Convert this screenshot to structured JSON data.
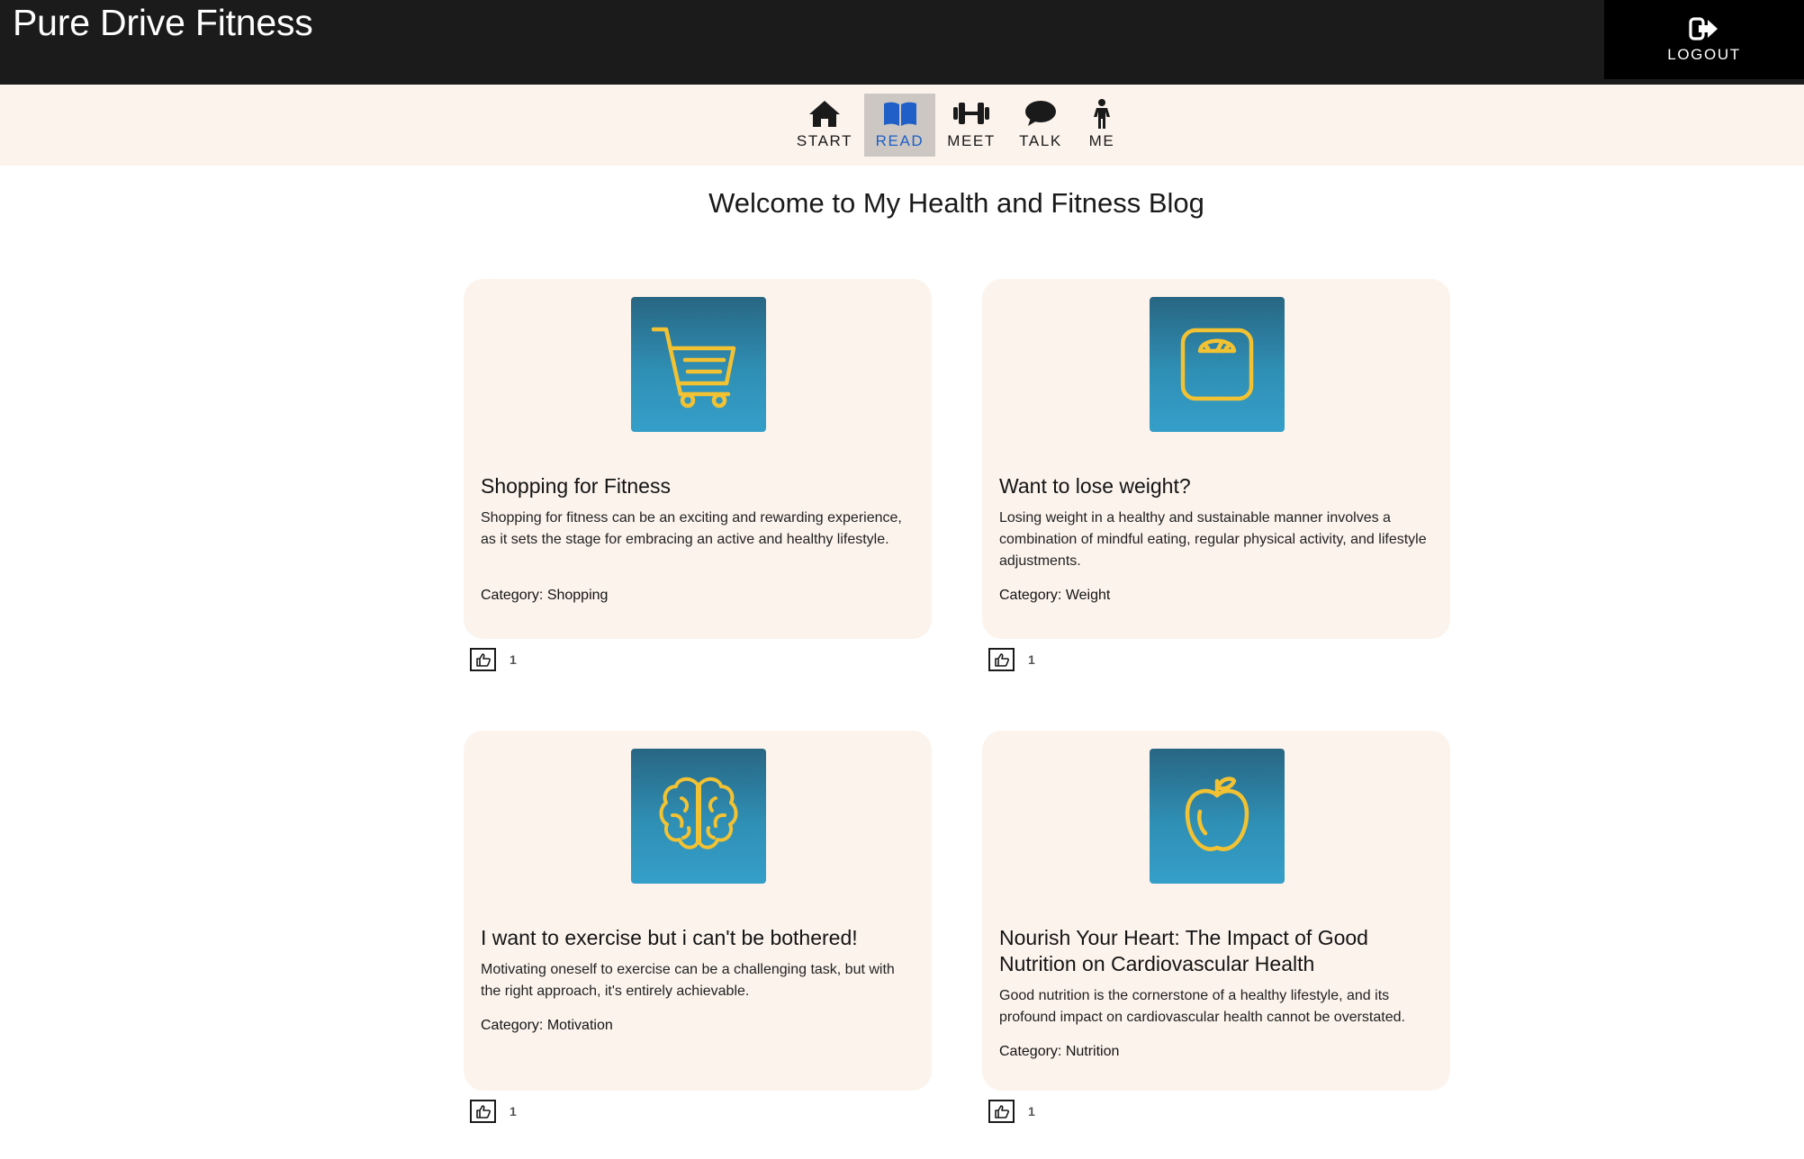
{
  "header": {
    "app_title": "Pure Drive Fitness",
    "logout_label": "LOGOUT",
    "logout_icon": "sign-out-icon"
  },
  "nav": {
    "active": "READ",
    "active_color": "#1f5fc7",
    "items": [
      {
        "label": "START",
        "icon": "home-icon"
      },
      {
        "label": "READ",
        "icon": "book-open-icon"
      },
      {
        "label": "MEET",
        "icon": "dumbbell-icon"
      },
      {
        "label": "TALK",
        "icon": "speech-bubble-icon"
      },
      {
        "label": "ME",
        "icon": "person-icon"
      }
    ]
  },
  "main": {
    "heading": "Welcome to My Health and Fitness Blog"
  },
  "colors": {
    "header_bg": "#1b1b1b",
    "card_bg": "#fbf3ec",
    "icon_tile": "#2f8fb5",
    "icon_stroke": "#f2c232"
  },
  "posts": [
    {
      "icon": "shopping-cart-icon",
      "title": "Shopping for Fitness",
      "excerpt": "Shopping for fitness can be an exciting and rewarding experience, as it sets the stage for embracing an active and healthy lifestyle.",
      "category": "Category: Shopping",
      "likes": "1"
    },
    {
      "icon": "weighing-scale-icon",
      "title": "Want to lose weight?",
      "excerpt": "Losing weight in a healthy and sustainable manner involves a combination of mindful eating, regular physical activity, and lifestyle adjustments.",
      "category": "Category: Weight",
      "likes": "1"
    },
    {
      "icon": "brain-icon",
      "title": "I want to exercise but i can't be bothered!",
      "excerpt": "Motivating oneself to exercise can be a challenging task, but with the right approach, it's entirely achievable.",
      "category": "Category: Motivation",
      "likes": "1"
    },
    {
      "icon": "apple-icon",
      "title": "Nourish Your Heart: The Impact of Good Nutrition on Cardiovascular Health",
      "excerpt": "Good nutrition is the cornerstone of a healthy lifestyle, and its profound impact on cardiovascular health cannot be overstated.",
      "category": "Category: Nutrition",
      "likes": "1"
    }
  ]
}
